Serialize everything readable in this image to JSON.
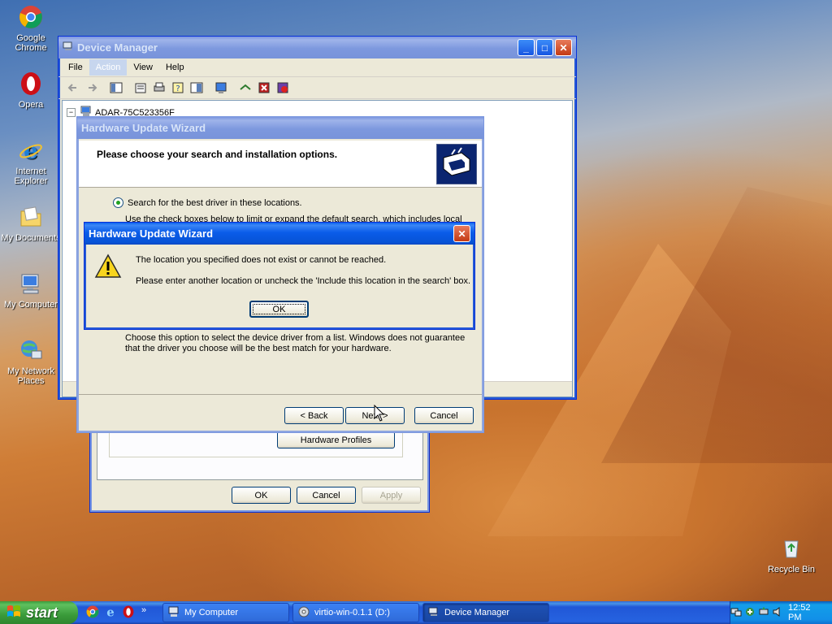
{
  "desktop_icons": [
    {
      "label": "Google Chrome",
      "icon": "chrome-icon"
    },
    {
      "label": "Opera",
      "icon": "opera-icon"
    },
    {
      "label": "Internet Explorer",
      "icon": "internet-explorer-icon"
    },
    {
      "label": "My Documents",
      "icon": "folder-icon"
    },
    {
      "label": "My Computer",
      "icon": "computer-icon"
    },
    {
      "label": "My Network Places",
      "icon": "network-icon"
    },
    {
      "label": "Recycle Bin",
      "icon": "recycle-bin-icon"
    }
  ],
  "device_manager": {
    "title": "Device Manager",
    "menu": [
      "File",
      "Action",
      "View",
      "Help"
    ],
    "tree_root": "ADAR-75C523356F"
  },
  "properties_window": {
    "hardware_profiles_button": "Hardware Profiles",
    "ok": "OK",
    "cancel": "Cancel",
    "apply": "Apply"
  },
  "wizard": {
    "title": "Hardware Update Wizard",
    "header": "Please choose your search and installation options.",
    "option_search": "Search for the best driver in these locations.",
    "option_search_desc": "Use the check boxes below to limit or expand the default search, which includes local",
    "option_choose_desc": "Choose this option to select the device driver from a list.  Windows does not guarantee that the driver you choose will be the best match for your hardware.",
    "back": "< Back",
    "next": "Next >",
    "cancel": "Cancel"
  },
  "alert": {
    "title": "Hardware Update Wizard",
    "line1": "The location you specified does not exist or cannot be reached.",
    "line2": "Please enter another location or uncheck the 'Include this location in the search' box.",
    "ok": "OK"
  },
  "taskbar": {
    "start": "start",
    "tasks": [
      "My Computer",
      "virtio-win-0.1.1 (D:)",
      "Device Manager"
    ],
    "clock": "12:52 PM"
  },
  "colors": {
    "xp_blue": "#0a5ce9",
    "xp_face": "#ece9d8",
    "start_green": "#3a9b3a"
  }
}
